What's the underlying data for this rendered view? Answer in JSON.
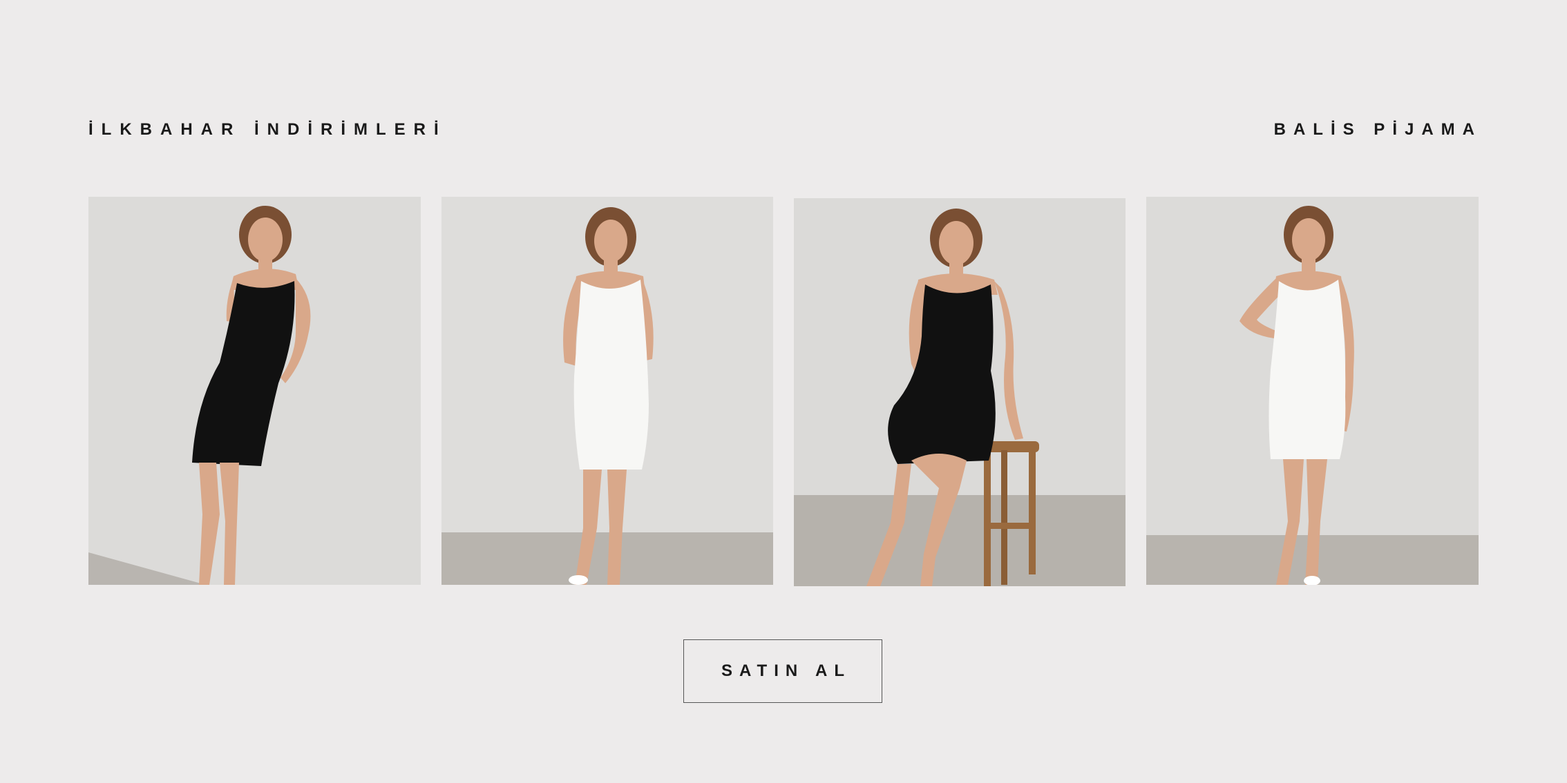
{
  "header": {
    "left_title": "İLKBAHAR İNDİRİMLERİ",
    "right_title": "BALİS PİJAMA"
  },
  "products": [
    {
      "dress_color": "#111111",
      "pose": "leaning"
    },
    {
      "dress_color": "#f7f7f5",
      "pose": "standing"
    },
    {
      "dress_color": "#111111",
      "pose": "seated-stool"
    },
    {
      "dress_color": "#f7f7f5",
      "pose": "hand-on-hip"
    }
  ],
  "cta": {
    "label": "SATIN AL"
  },
  "colors": {
    "background": "#edebeb",
    "wall": "#dcdbd9",
    "floor": "#b9b5b0",
    "skin": "#d9a88a",
    "hair": "#7a4f33",
    "stool": "#9a6a3e"
  }
}
